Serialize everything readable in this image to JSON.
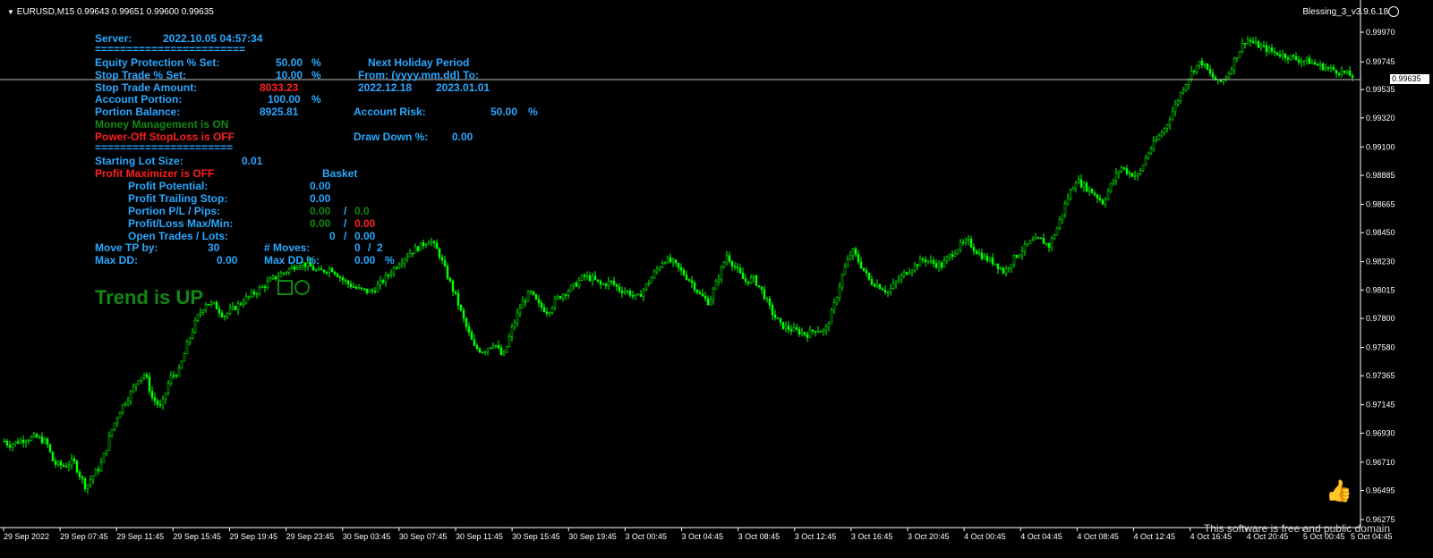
{
  "header": {
    "symbol_text": "EURUSD,M15  0.99643 0.99651 0.99600 0.99635",
    "ea_name": "Blessing_3_v3.9.6.18"
  },
  "current_price": "0.99635",
  "colors": {
    "background": "#000000",
    "candle": "#00ff00",
    "label_blue": "#2aa8ff",
    "label_green": "#118811",
    "label_red": "#ff1f1f",
    "axis_text": "#ffffff"
  },
  "panel": {
    "server_label": "Server:",
    "server_value": "2022.10.05 04:57:34",
    "sep1": "========================",
    "eq_prot_label": "Equity Protection % Set:",
    "eq_prot_value": "50.00",
    "eq_prot_unit": "%",
    "stop_trade_pct_label": "Stop Trade % Set:",
    "stop_trade_pct_value": "10.00",
    "stop_trade_pct_unit": "%",
    "stop_trade_amt_label": "Stop Trade Amount:",
    "stop_trade_amt_value": "8033.23",
    "acct_portion_label": "Account Portion:",
    "acct_portion_value": "100.00",
    "acct_portion_unit": "%",
    "portion_balance_label": "Portion Balance:",
    "portion_balance_value": "8925.81",
    "mm_status": "Money Management is ON",
    "poweroff_status": "Power-Off StopLoss is OFF",
    "sep2": "======================",
    "holiday_title": "Next Holiday Period",
    "holiday_format": "From: (yyyy.mm.dd) To:",
    "holiday_from": "2022.12.18",
    "holiday_to": "2023.01.01",
    "account_risk_label": "Account Risk:",
    "account_risk_value": "50.00",
    "account_risk_unit": "%",
    "drawdown_label": "Draw Down %:",
    "drawdown_value": "0.00",
    "lot_label": "Starting Lot Size:",
    "lot_value": "0.01",
    "profit_max_status": "Profit Maximizer is OFF",
    "basket_label": "Basket",
    "profit_potential_label": "Profit Potential:",
    "profit_potential_value": "0.00",
    "profit_trailing_label": "Profit Trailing Stop:",
    "profit_trailing_value": "0.00",
    "portion_pl_label": "Portion P/L / Pips:",
    "portion_pl_value": "0.00",
    "portion_pl_sep": "/",
    "portion_pips_value": "0.0",
    "pl_maxmin_label": "Profit/Loss Max/Min:",
    "pl_max_value": "0.00",
    "pl_sep": "/",
    "pl_min_value": "0.00",
    "open_trades_label": "Open Trades / Lots:",
    "open_trades_value": "0",
    "open_trades_sep": "/",
    "open_lots_value": "0.00",
    "move_tp_label": "Move TP by:",
    "move_tp_value": "30",
    "moves_label": "# Moves:",
    "moves_value": "0",
    "moves_sep": "/",
    "moves_max": "2",
    "maxdd_label": "Max DD:",
    "maxdd_value": "0.00",
    "maxdd_pct_label": "Max DD %:",
    "maxdd_pct_value": "0.00",
    "maxdd_pct_unit": "%"
  },
  "trend_text": "Trend is UP",
  "footer_text": "This software is free and public domain",
  "chart_data": {
    "type": "candlestick",
    "price_axis": [
      "0.99970",
      "0.99745",
      "0.99535",
      "0.99320",
      "0.99100",
      "0.98885",
      "0.98665",
      "0.98450",
      "0.98230",
      "0.98015",
      "0.97800",
      "0.97580",
      "0.97365",
      "0.97145",
      "0.96930",
      "0.96710",
      "0.96495",
      "0.96275"
    ],
    "ylim": [
      0.96275,
      0.9997
    ],
    "time_axis": [
      "29 Sep 2022",
      "29 Sep 07:45",
      "29 Sep 11:45",
      "29 Sep 15:45",
      "29 Sep 19:45",
      "29 Sep 23:45",
      "30 Sep 03:45",
      "30 Sep 07:45",
      "30 Sep 11:45",
      "30 Sep 15:45",
      "30 Sep 19:45",
      "3 Oct 00:45",
      "3 Oct 04:45",
      "3 Oct 08:45",
      "3 Oct 12:45",
      "3 Oct 16:45",
      "3 Oct 20:45",
      "4 Oct 00:45",
      "4 Oct 04:45",
      "4 Oct 08:45",
      "4 Oct 12:45",
      "4 Oct 16:45",
      "4 Oct 20:45",
      "5 Oct 00:45",
      "5 Oct 04:45"
    ],
    "close_path": [
      [
        0,
        0.969
      ],
      [
        10,
        0.9684
      ],
      [
        25,
        0.9688
      ],
      [
        40,
        0.969
      ],
      [
        52,
        0.9686
      ],
      [
        60,
        0.967
      ],
      [
        72,
        0.9668
      ],
      [
        82,
        0.9672
      ],
      [
        90,
        0.966
      ],
      [
        96,
        0.9652
      ],
      [
        103,
        0.966
      ],
      [
        112,
        0.9668
      ],
      [
        118,
        0.968
      ],
      [
        125,
        0.9696
      ],
      [
        135,
        0.9712
      ],
      [
        145,
        0.9722
      ],
      [
        155,
        0.9735
      ],
      [
        162,
        0.9738
      ],
      [
        170,
        0.972
      ],
      [
        180,
        0.9712
      ],
      [
        190,
        0.9735
      ],
      [
        200,
        0.974
      ],
      [
        210,
        0.9762
      ],
      [
        220,
        0.978
      ],
      [
        230,
        0.9792
      ],
      [
        240,
        0.979
      ],
      [
        250,
        0.9782
      ],
      [
        262,
        0.9788
      ],
      [
        275,
        0.9795
      ],
      [
        290,
        0.9802
      ],
      [
        305,
        0.981
      ],
      [
        320,
        0.9816
      ],
      [
        335,
        0.9822
      ],
      [
        345,
        0.982
      ],
      [
        355,
        0.9815
      ],
      [
        370,
        0.9818
      ],
      [
        385,
        0.9808
      ],
      [
        400,
        0.9802
      ],
      [
        415,
        0.98
      ],
      [
        430,
        0.981
      ],
      [
        445,
        0.9822
      ],
      [
        458,
        0.983
      ],
      [
        470,
        0.9835
      ],
      [
        480,
        0.984
      ],
      [
        490,
        0.983
      ],
      [
        500,
        0.9812
      ],
      [
        510,
        0.9795
      ],
      [
        520,
        0.9775
      ],
      [
        530,
        0.9758
      ],
      [
        540,
        0.9755
      ],
      [
        552,
        0.9762
      ],
      [
        562,
        0.975
      ],
      [
        572,
        0.9772
      ],
      [
        582,
        0.979
      ],
      [
        592,
        0.98
      ],
      [
        602,
        0.979
      ],
      [
        612,
        0.9785
      ],
      [
        622,
        0.9795
      ],
      [
        632,
        0.98
      ],
      [
        642,
        0.9805
      ],
      [
        652,
        0.9812
      ],
      [
        662,
        0.981
      ],
      [
        672,
        0.9805
      ],
      [
        682,
        0.9808
      ],
      [
        692,
        0.9802
      ],
      [
        702,
        0.98
      ],
      [
        712,
        0.9795
      ],
      [
        722,
        0.9805
      ],
      [
        732,
        0.9815
      ],
      [
        742,
        0.9825
      ],
      [
        752,
        0.9822
      ],
      [
        762,
        0.9815
      ],
      [
        772,
        0.9808
      ],
      [
        782,
        0.9798
      ],
      [
        792,
        0.9792
      ],
      [
        802,
        0.981
      ],
      [
        812,
        0.9828
      ],
      [
        822,
        0.9818
      ],
      [
        832,
        0.9808
      ],
      [
        842,
        0.981
      ],
      [
        852,
        0.98
      ],
      [
        862,
        0.9785
      ],
      [
        872,
        0.9775
      ],
      [
        882,
        0.9772
      ],
      [
        892,
        0.977
      ],
      [
        902,
        0.9768
      ],
      [
        912,
        0.9772
      ],
      [
        922,
        0.977
      ],
      [
        932,
        0.979
      ],
      [
        942,
        0.9815
      ],
      [
        952,
        0.9832
      ],
      [
        962,
        0.982
      ],
      [
        972,
        0.9808
      ],
      [
        982,
        0.9805
      ],
      [
        992,
        0.98
      ],
      [
        1002,
        0.9808
      ],
      [
        1012,
        0.9815
      ],
      [
        1022,
        0.982
      ],
      [
        1032,
        0.9825
      ],
      [
        1042,
        0.9822
      ],
      [
        1052,
        0.982
      ],
      [
        1062,
        0.9828
      ],
      [
        1072,
        0.9835
      ],
      [
        1082,
        0.9838
      ],
      [
        1092,
        0.983
      ],
      [
        1102,
        0.9825
      ],
      [
        1112,
        0.9822
      ],
      [
        1122,
        0.9815
      ],
      [
        1132,
        0.9825
      ],
      [
        1142,
        0.9832
      ],
      [
        1152,
        0.9838
      ],
      [
        1162,
        0.984
      ],
      [
        1172,
        0.9835
      ],
      [
        1182,
        0.985
      ],
      [
        1192,
        0.987
      ],
      [
        1202,
        0.9885
      ],
      [
        1212,
        0.988
      ],
      [
        1222,
        0.9875
      ],
      [
        1232,
        0.9868
      ],
      [
        1242,
        0.9882
      ],
      [
        1252,
        0.9895
      ],
      [
        1262,
        0.989
      ],
      [
        1272,
        0.9888
      ],
      [
        1282,
        0.9905
      ],
      [
        1292,
        0.9915
      ],
      [
        1302,
        0.9925
      ],
      [
        1312,
        0.994
      ],
      [
        1322,
        0.9955
      ],
      [
        1332,
        0.9968
      ],
      [
        1342,
        0.9975
      ],
      [
        1352,
        0.9965
      ],
      [
        1362,
        0.9958
      ],
      [
        1372,
        0.9965
      ],
      [
        1382,
        0.998
      ],
      [
        1392,
        0.9992
      ],
      [
        1402,
        0.9988
      ],
      [
        1412,
        0.9985
      ],
      [
        1422,
        0.9982
      ],
      [
        1432,
        0.998
      ],
      [
        1442,
        0.9978
      ],
      [
        1452,
        0.9976
      ],
      [
        1462,
        0.9975
      ],
      [
        1472,
        0.9972
      ],
      [
        1482,
        0.997
      ],
      [
        1492,
        0.9968
      ],
      [
        1502,
        0.9966
      ],
      [
        1512,
        0.99635
      ]
    ]
  }
}
